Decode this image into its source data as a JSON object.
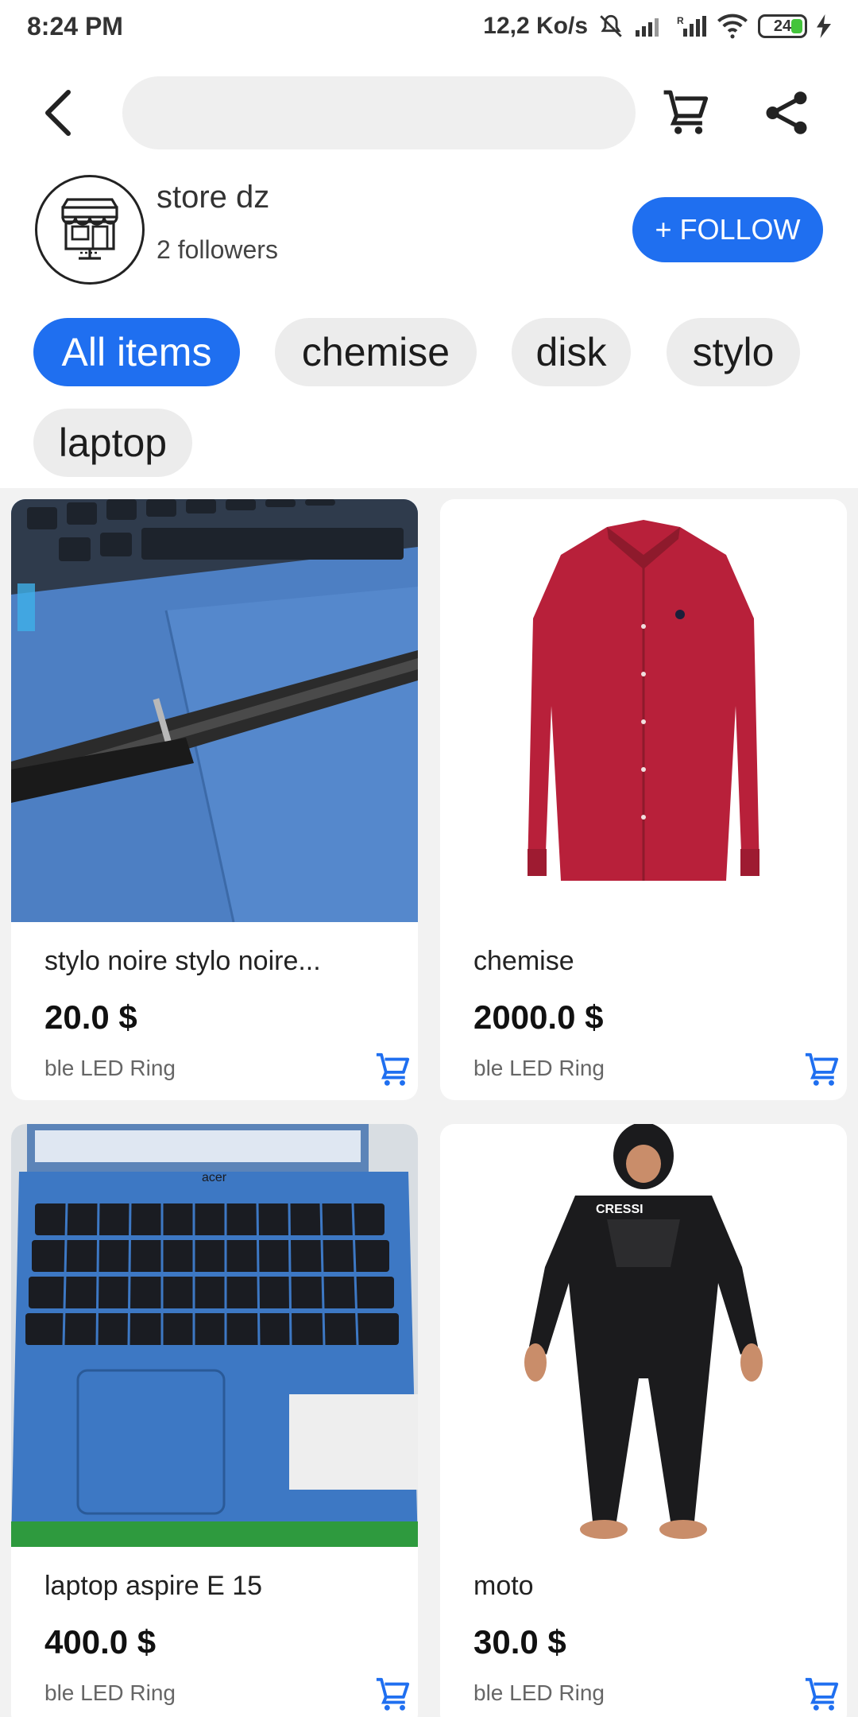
{
  "status_bar": {
    "time": "8:24 PM",
    "speed": "12,2 Ko/s",
    "battery": "24"
  },
  "header": {
    "search_placeholder": "",
    "icons": [
      "back-arrow-icon",
      "cart-icon",
      "share-icon"
    ]
  },
  "store": {
    "name": "store dz",
    "followers": "2  followers",
    "follow_label": "+ FOLLOW",
    "avatar_icon": "storefront-icon"
  },
  "categories": [
    {
      "label": "All items",
      "active": true
    },
    {
      "label": "chemise",
      "active": false
    },
    {
      "label": "disk",
      "active": false
    },
    {
      "label": "stylo",
      "active": false
    },
    {
      "label": "laptop",
      "active": false
    }
  ],
  "products": [
    {
      "title": "stylo noire stylo noire...",
      "price": "20.0 $",
      "subtitle": "ble LED Ring",
      "image": "pen-on-laptop-photo"
    },
    {
      "title": "chemise",
      "price": "2000.0 $",
      "subtitle": "ble LED Ring",
      "image": "red-shirt-photo"
    },
    {
      "title": "laptop aspire E 15",
      "price": "400.0 $",
      "subtitle": "ble LED Ring",
      "image": "blue-laptop-photo"
    },
    {
      "title": "moto",
      "price": "30.0 $",
      "subtitle": "ble LED Ring",
      "image": "wetsuit-photo"
    }
  ],
  "colors": {
    "accent": "#1f6ff0",
    "chip_bg": "#ececec",
    "grid_bg": "#f2f2f2"
  }
}
